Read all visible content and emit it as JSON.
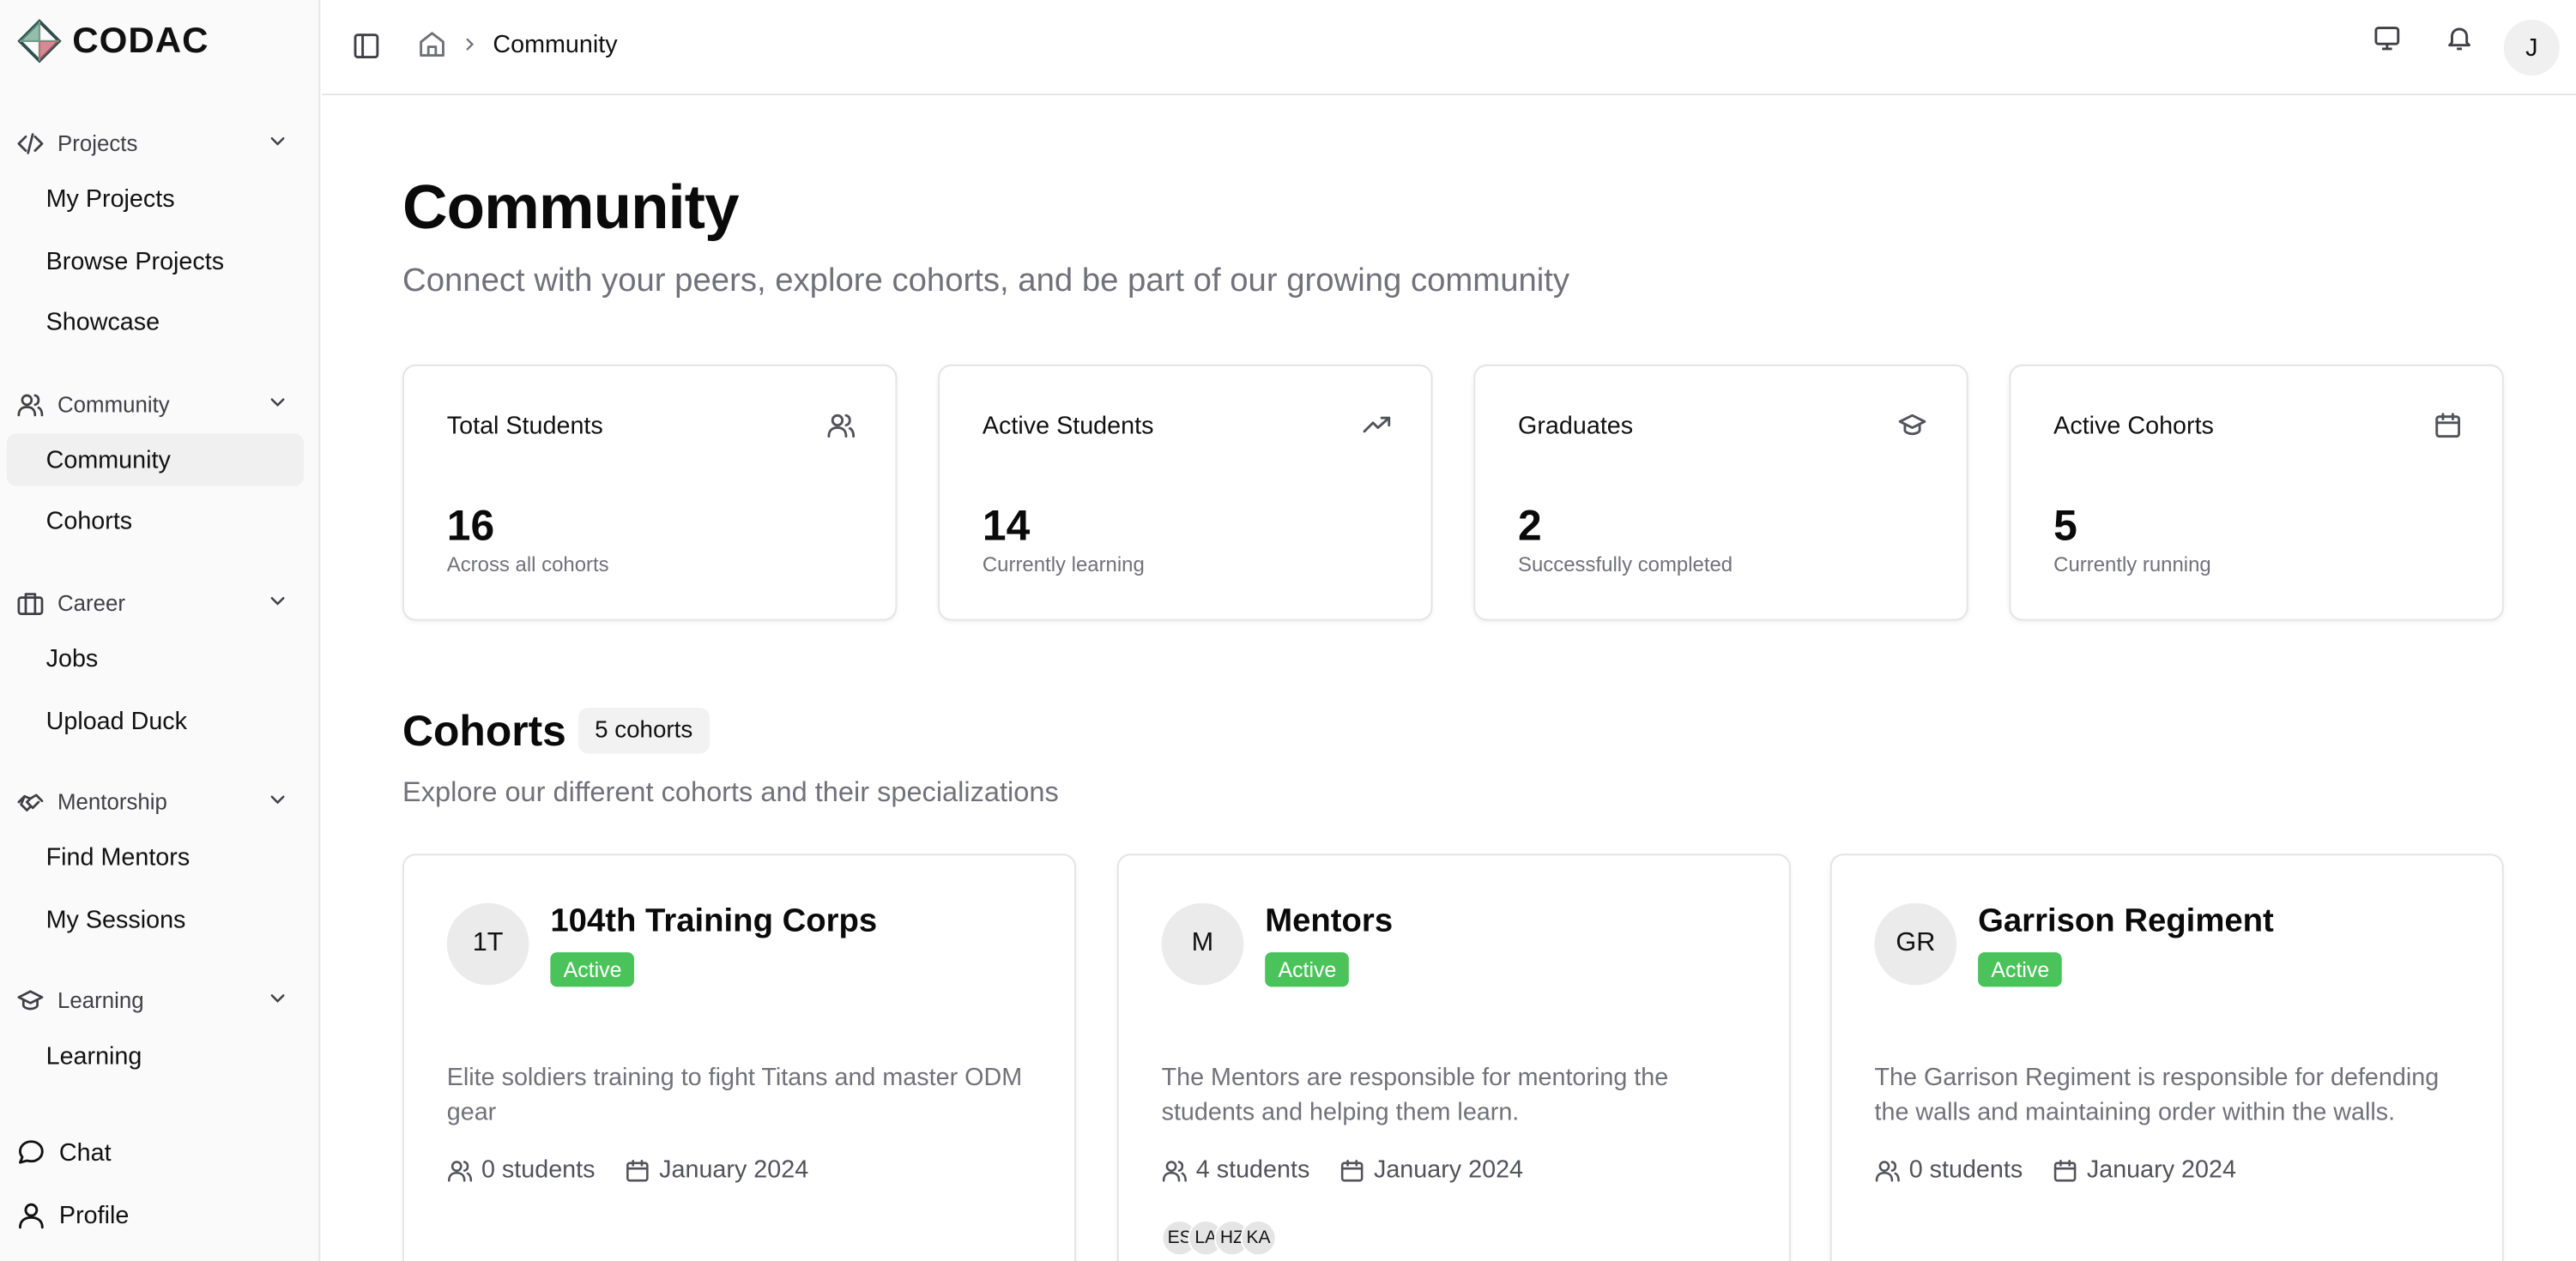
{
  "app": {
    "brand": "CODAC"
  },
  "sidebar": {
    "groups": [
      {
        "label": "Projects",
        "icon": "code-icon",
        "items": [
          "My Projects",
          "Browse Projects",
          "Showcase"
        ]
      },
      {
        "label": "Community",
        "icon": "users-icon",
        "items": [
          "Community",
          "Cohorts"
        ]
      },
      {
        "label": "Career",
        "icon": "briefcase-icon",
        "items": [
          "Jobs",
          "Upload Duck"
        ]
      },
      {
        "label": "Mentorship",
        "icon": "handshake-icon",
        "items": [
          "Find Mentors",
          "My Sessions"
        ]
      },
      {
        "label": "Learning",
        "icon": "graduation-cap-icon",
        "items": [
          "Learning"
        ]
      }
    ],
    "bottom": [
      {
        "label": "Chat",
        "icon": "chat-icon"
      },
      {
        "label": "Profile",
        "icon": "user-icon"
      }
    ],
    "active_item": "Community"
  },
  "header": {
    "breadcrumb_current": "Community",
    "user_initial": "J"
  },
  "main": {
    "title": "Community",
    "subtitle": "Connect with your peers, explore cohorts, and be part of our growing community",
    "stats": [
      {
        "label": "Total Students",
        "value": "16",
        "note": "Across all cohorts",
        "icon": "users-icon"
      },
      {
        "label": "Active Students",
        "value": "14",
        "note": "Currently learning",
        "icon": "trending-up-icon"
      },
      {
        "label": "Graduates",
        "value": "2",
        "note": "Successfully completed",
        "icon": "graduation-cap-icon"
      },
      {
        "label": "Active Cohorts",
        "value": "5",
        "note": "Currently running",
        "icon": "calendar-icon"
      }
    ],
    "cohorts_section": {
      "title": "Cohorts",
      "count_badge": "5 cohorts",
      "subtitle": "Explore our different cohorts and their specializations"
    },
    "cohorts": [
      {
        "initials": "1T",
        "name": "104th Training Corps",
        "status": "Active",
        "description": "Elite soldiers training to fight Titans and master ODM gear",
        "students": "0 students",
        "date": "January 2024",
        "members": []
      },
      {
        "initials": "M",
        "name": "Mentors",
        "status": "Active",
        "description": "The Mentors are responsible for mentoring the students and helping them learn.",
        "students": "4 students",
        "date": "January 2024",
        "members": [
          "ES",
          "LA",
          "HZ",
          "KA"
        ]
      },
      {
        "initials": "GR",
        "name": "Garrison Regiment",
        "status": "Active",
        "description": "The Garrison Regiment is responsible for defending the walls and maintaining order within the walls.",
        "students": "0 students",
        "date": "January 2024",
        "members": []
      }
    ]
  },
  "colors": {
    "accent_active": "#4ac35b",
    "muted_text": "#71717a",
    "border": "#e4e4e7"
  }
}
